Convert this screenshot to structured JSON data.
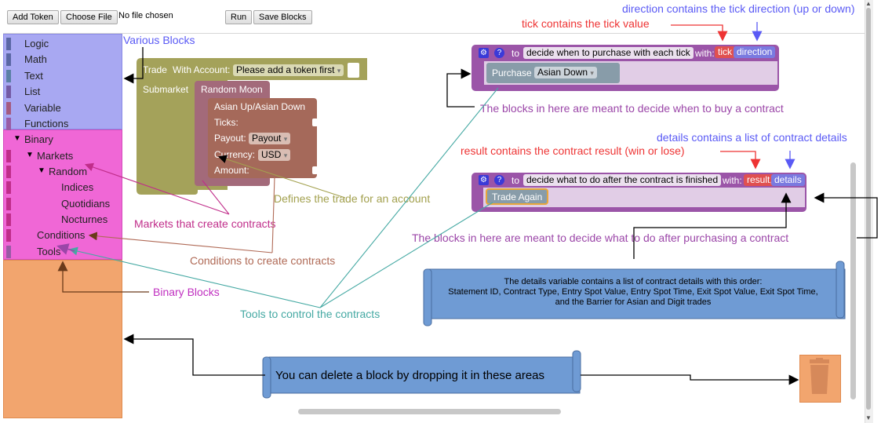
{
  "toolbar": {
    "add_token": "Add Token",
    "choose_file": "Choose File",
    "file_status": "No file chosen",
    "run": "Run",
    "save_blocks": "Save Blocks"
  },
  "toolbox": {
    "categories": [
      "Logic",
      "Math",
      "Text",
      "List",
      "Variable",
      "Functions"
    ],
    "binary": {
      "label": "Binary",
      "markets": "Markets",
      "random": "Random",
      "random_children": [
        "Indices",
        "Quotidians",
        "Nocturnes"
      ],
      "conditions": "Conditions",
      "tools": "Tools"
    }
  },
  "trade_block": {
    "trade": "Trade",
    "with_account": "With Account:",
    "account_value": "Please add a token first",
    "submarket": "Submarket",
    "submarket_value": "Random Moon",
    "condition_title": "Asian Up/Asian Down",
    "ticks": "Ticks:",
    "payout_label": "Payout:",
    "payout_value": "Payout",
    "currency_label": "Currency:",
    "currency_value": "USD",
    "amount": "Amount:"
  },
  "purchase_block": {
    "to": "to",
    "name": "decide when to purchase with each tick",
    "with": "with:",
    "param1": "tick",
    "param2": "direction",
    "purchase": "Purchase",
    "purchase_value": "Asian Down"
  },
  "after_block": {
    "to": "to",
    "name": "decide what to do after the contract is finished",
    "with": "with:",
    "param1": "result,",
    "param2": "details",
    "trade_again": "Trade Again"
  },
  "annotations": {
    "direction": "direction contains the tick direction (up or down)",
    "tick": "tick contains the tick value",
    "various_blocks": "Various Blocks",
    "buy_contract": "The blocks in here are meant to decide when to buy a contract",
    "details": "details contains a list of contract details",
    "result": "result contains the contract result (win or lose)",
    "defines_trade": "Defines the trade for an account",
    "markets": "Markets that create contracts",
    "after_purchase": "The blocks in here are meant to decide what to do after purchasing a contract",
    "conditions": "Conditions to create contracts",
    "binary_blocks": "Binary Blocks",
    "tools": "Tools to control the contracts",
    "details_note_title": "The details variable contains a list of contract details with this order:",
    "details_note_line2": "Statement ID, Contract Type, Entry Spot Value, Entry Spot Time, Exit Spot Value, Exit Spot Time,",
    "details_note_line3": "and the Barrier for Asian and Digit trades",
    "delete_note": "You can delete a block by dropping it in these areas"
  },
  "colors": {
    "toolbox_blue": "#a8a8f2",
    "toolbox_pink": "#f067d6",
    "toolbox_orange": "#f2a56e",
    "trade_olive": "#a4a25a",
    "submarket_mauve": "#a36a7a",
    "condition_brown": "#a5695a",
    "purple_block": "#9b55a8",
    "note_blue": "#6f9bd4",
    "arrow_red": "#ee3333",
    "arrow_blue": "#5a5af5",
    "text_purple": "#9b46a8",
    "text_teal": "#45a9a3",
    "text_olive": "#a3a14f",
    "text_brown": "#b06a56"
  }
}
